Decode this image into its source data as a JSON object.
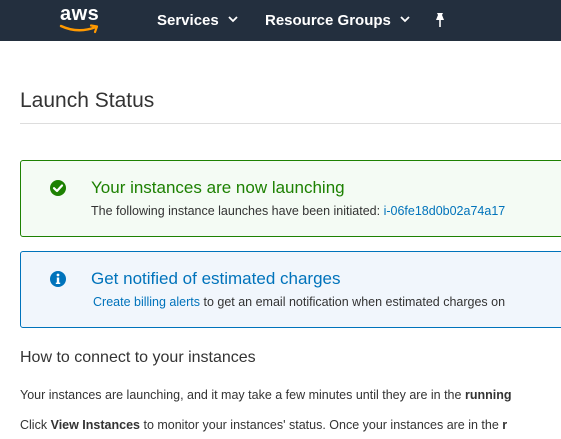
{
  "header": {
    "logo_text": "aws",
    "services_label": "Services",
    "resource_groups_label": "Resource Groups",
    "chevron": "⌄"
  },
  "page": {
    "title": "Launch Status"
  },
  "alert_success": {
    "title": "Your instances are now launching",
    "body_prefix": "The following instance launches have been initiated:",
    "instance_id": "i-06fe18d0b02a74a17"
  },
  "alert_info": {
    "title": "Get notified of estimated charges",
    "link_text": "Create billing alerts",
    "body_suffix": "to get an email notification when estimated charges on"
  },
  "connect": {
    "heading": "How to connect to your instances",
    "para1_text": "Your instances are launching, and it may take a few minutes until they are in the",
    "para1_bold": "running",
    "para2_prefix": "Click",
    "para2_bold": "View Instances",
    "para2_middle": "to monitor your instances' status. Once your instances are in the",
    "para2_bold_end": "r"
  },
  "colors": {
    "header_bg": "#232f3e",
    "success": "#1d8102",
    "info": "#0073bb",
    "aws_smile": "#ff9900"
  },
  "icons": [
    "aws-logo",
    "chevron-down-icon",
    "pin-icon",
    "check-circle-icon",
    "info-circle-icon"
  ]
}
